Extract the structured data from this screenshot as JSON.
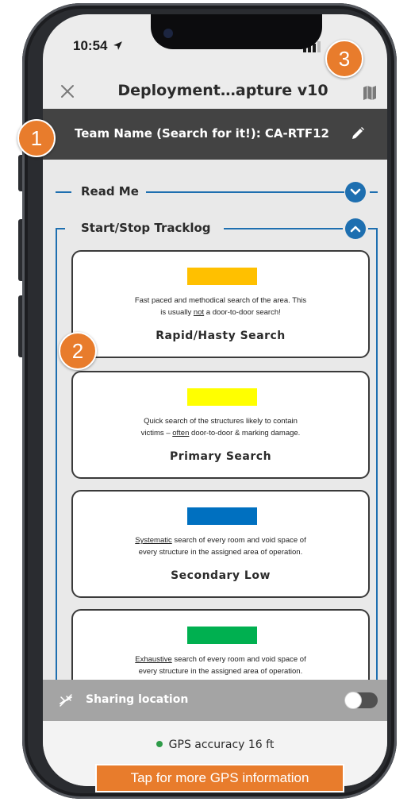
{
  "status_bar": {
    "time": "10:54"
  },
  "header": {
    "title": "Deployment…apture v10"
  },
  "team_bar": {
    "label": "Team Name (Search for it!): CA-RTF12"
  },
  "sections": [
    {
      "label": "Read Me",
      "state": "collapsed"
    },
    {
      "label": "Start/Stop Tracklog",
      "state": "expanded"
    }
  ],
  "cards": [
    {
      "color": "#ffc000",
      "desc_line1_pre": "Fast paced and methodical search of the area. This",
      "desc_line2_pre": "is usually ",
      "desc_emph": "not",
      "desc_line2_post": " a door-to-door search!",
      "title": "Rapid/Hasty Search"
    },
    {
      "color": "#ffff00",
      "desc_line1_pre": "Quick search of the structures likely to contain",
      "desc_line2_pre": "victims – ",
      "desc_emph": "often",
      "desc_line2_post": " door-to-door & marking damage.",
      "title": "Primary Search"
    },
    {
      "color": "#0070c0",
      "desc_emph": "Systematic",
      "desc_line1_post": " search of every room and void space of",
      "desc_line2": "every structure in the assigned area of operation.",
      "title": "Secondary Low"
    },
    {
      "color": "#00b050",
      "desc_emph": "Exhaustive",
      "desc_line1_post": " search of every room and void space of",
      "desc_line2": "every structure in the assigned area of operation."
    }
  ],
  "sharing": {
    "label": "Sharing location",
    "enabled": false
  },
  "gps": {
    "accuracy_text": "GPS accuracy 16 ft",
    "status_color": "#2e9b48"
  },
  "annotations": {
    "badge_1": "1",
    "badge_2": "2",
    "badge_3": "3",
    "banner": "Tap for more GPS information"
  },
  "icons": [
    "location-arrow-icon",
    "signal-icon",
    "close-icon",
    "map-icon",
    "pencil-icon",
    "chevron-down-icon",
    "chevron-up-icon",
    "location-sharing-icon"
  ],
  "colors": {
    "accent": "#1e6fb0",
    "team_bar": "#434343",
    "callout": "#e87c2c"
  }
}
